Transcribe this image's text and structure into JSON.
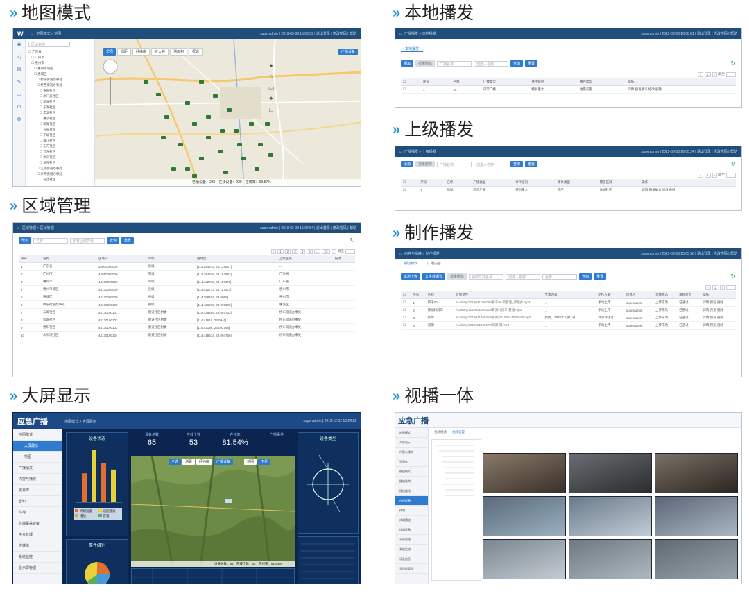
{
  "sections": {
    "map": {
      "title": "地图模式"
    },
    "local": {
      "title": "本地播发"
    },
    "upper": {
      "title": "上级播发"
    },
    "region": {
      "title": "区域管理"
    },
    "make": {
      "title": "制作播发"
    },
    "screen": {
      "title": "大屏显示"
    },
    "video": {
      "title": "视播一体"
    }
  },
  "map_shot": {
    "crumb": "地图模式 > 地图",
    "user_info": "superadmin | 2019-03-08 15:08:39 | 退出登录 | 修改密码 | 帮助",
    "search_placeholder": "区域名称",
    "tree": [
      "广东省",
      "广州市",
      "惠州市",
      "惠州市城区",
      "惠城区",
      "桥东街道办事处",
      "桥西街道办事处",
      "惠阳社区",
      "水门居社区",
      "新湖社区",
      "东湖社区",
      "丰源社区",
      "惠淡社区",
      "新湖社区",
      "花园社区",
      "下城社区",
      "横江社区",
      "东方社区",
      "江东社区",
      "水贝社区",
      "湖东社区",
      "江北街道办事处",
      "东平街道办事处",
      "花边社区"
    ],
    "toolbar": [
      "全选",
      "测距",
      "经纬度",
      "扩大包",
      "测面积",
      "框选"
    ],
    "right_btn": "广播设备",
    "bottom_info": "已播设备：230　在线设备：229　在线率：99.57%"
  },
  "local_shot": {
    "crumb": "广播播发 > 本地播发",
    "user_info": "superadmin | 2019-03-08 16:08:01 | 退出登录 | 修改密码 | 帮助",
    "tab": "本地播发",
    "add_btn": "添加",
    "del_btn": "批量删除",
    "search1": "广播名称",
    "search2": "创建人名称",
    "query_btn": "查询",
    "reset_btn": "重置",
    "columns": [
      "序号",
      "名称",
      "广播类型",
      "事件级别",
      "事件类型",
      "操作"
    ],
    "rows": [
      {
        "no": "1",
        "name": "66",
        "type": "日常广播",
        "level": "特别重大",
        "etype": "地震灾害",
        "ops": "详情 播发确认 修改 删除"
      }
    ],
    "page_label": "跳至"
  },
  "upper_shot": {
    "crumb": "广播播发 > 上级播发",
    "user_info": "superadmin | 2019-03-08 16:00:24 | 退出登录 | 修改密码 | 帮助",
    "add_btn": "添加",
    "del_btn": "批量删除",
    "search1": "广播名称",
    "search2": "创建人名称",
    "query_btn": "查询",
    "reset_btn": "重置",
    "columns": [
      "序号",
      "名称",
      "广播类型",
      "事件级别",
      "事件类型",
      "覆盖区域",
      "操作"
    ],
    "rows": [
      {
        "no": "1",
        "name": "测试",
        "type": "应急广播",
        "level": "特别重大",
        "etype": "疫严",
        "area": "东湖社区",
        "ops": "详情 播发确认 修改 删除"
      }
    ],
    "page_label": "跳至"
  },
  "region_shot": {
    "crumb": "区域管理 > 区域管理",
    "user_info": "superadmin | 2019-03-08 15:04:54 | 退出登录 | 修改密码 | 帮助",
    "add_btn": "增加",
    "search1": "名称",
    "search2": "所有区域等级",
    "query_btn": "查询",
    "reset_btn": "重置",
    "columns": [
      "序号",
      "名称",
      "区域码",
      "等级",
      "经纬度",
      "上级区域",
      "描述"
    ],
    "rows": [
      {
        "no": "1",
        "name": "广东省",
        "code": "44000000000",
        "level": "省级",
        "coord": "[113.264474, 23.129537]",
        "parent": "--"
      },
      {
        "no": "2",
        "name": "广州市",
        "code": "44010000000",
        "level": "市级",
        "coord": "[113.264919, 23.153887]",
        "parent": "广东省"
      },
      {
        "no": "3",
        "name": "惠州市",
        "code": "44130000000",
        "level": "市级",
        "coord": "[114.422773, 23.117473]",
        "parent": "广东省"
      },
      {
        "no": "4",
        "name": "惠州市城区",
        "code": "44130200000",
        "level": "县级",
        "coord": "[114.422773, 23.117473]",
        "parent": "惠州市"
      },
      {
        "no": "5",
        "name": "惠城区",
        "code": "44130200000",
        "level": "县级",
        "coord": "[114.388461, 23.0968]",
        "parent": "惠州市"
      },
      {
        "no": "6",
        "name": "桥东街道办事处",
        "code": "44130200100",
        "level": "镇级",
        "coord": "[114.426273, 23.090899]",
        "parent": "惠城区"
      },
      {
        "no": "7",
        "name": "东湖社区",
        "code": "44130100101",
        "level": "街道社区村委",
        "coord": "[114.436469, 23.087733]",
        "parent": "桥东街道办事处"
      },
      {
        "no": "8",
        "name": "新湖社区",
        "code": "44130100102",
        "level": "街道社区村委",
        "coord": "[114.41616, 23.0946]",
        "parent": "桥东街道办事处"
      },
      {
        "no": "9",
        "name": "惠阳社区",
        "code": "44130100103",
        "level": "街道社区村委",
        "coord": "[114.42198, 23.092768]",
        "parent": "桥东街道办事处"
      },
      {
        "no": "10",
        "name": "水贝湾社区",
        "code": "44130100104",
        "level": "街道社区村委",
        "coord": "[114.418634, 23.094758]",
        "parent": "桥东街道办事处"
      }
    ],
    "pages": [
      "1",
      "2",
      "3",
      "4",
      "5",
      "...",
      "23"
    ],
    "page_label": "跳至"
  },
  "make_shot": {
    "crumb": "内容与播映 > 制作播发",
    "user_info": "superadmin | 2019-03-08 15:05:56 | 退出登录 | 修改密码 | 帮助",
    "tabs": [
      "辅助制作",
      "广播内容"
    ],
    "btns": [
      "本地上传",
      "文字转语音",
      "批量删除"
    ],
    "search1": "辅助文件名称",
    "search2": "创建人名称",
    "select": "全部",
    "query_btn": "查询",
    "reset_btn": "重置",
    "columns": [
      "序号",
      "名称",
      "音频文件",
      "文本内容",
      "制作方式",
      "创建人",
      "音频状态",
      "审核状态",
      "操作"
    ],
    "rows": [
      {
        "no": "1",
        "name": "新干00",
        "file": "Auxiliary/2019021090730/新干00-新喜佳_新能办.mp3",
        "text": "...",
        "mode": "手动上传",
        "user": "superadmin",
        "astatus": "上传成功",
        "review": "已通过",
        "ops": "详情 预览 删除"
      },
      {
        "no": "2",
        "name": "黄湖村周年",
        "file": "Auxiliary/2019021409365/黄湖村周年-黄湖.mp3",
        "text": "...",
        "mode": "手动上传",
        "user": "superadmin",
        "astatus": "上传成功",
        "review": "已通过",
        "ops": "详情 预览 删除"
      },
      {
        "no": "3",
        "name": "新闻",
        "file": "Auxiliary/2019021409394/新闻/2019021409384B.mp3",
        "text": "新闻，1976年4月11日...",
        "mode": "文字转语音",
        "user": "superadmin",
        "astatus": "上传成功",
        "review": "已通过",
        "ops": "详情 预览 删除"
      },
      {
        "no": "4",
        "name": "测测",
        "file": "Auxiliary/2019021409570/测测-测.mp3",
        "text": "...",
        "mode": "手动上传",
        "user": "superadmin",
        "astatus": "上传成功",
        "review": "已通过",
        "ops": "详情 预览 删除"
      }
    ]
  },
  "screen_shot": {
    "logo": "应急广播",
    "crumb": "地图模式 > 大屏展示",
    "user_info": "superadmin | 2019-12-12 16:24:22",
    "menu": [
      "地图模式",
      "大屏展示",
      "地图",
      "广播播发",
      "内容与播映",
      "资源库",
      "告知",
      "终端",
      "终端覆盖设备",
      "平台管理",
      "终端维",
      "系统监控",
      "显示屏管理"
    ],
    "panels": {
      "device_status": "设备状态",
      "event_stat": "事件级别",
      "device_type": "设备类型"
    },
    "kpi": [
      {
        "label": "设备总数",
        "value": "65"
      },
      {
        "label": "在线个数",
        "value": "53"
      },
      {
        "label": "在线率",
        "value": "81.54%"
      },
      {
        "label": "广播事件",
        "value": ""
      }
    ],
    "bar_values": [
      0.55,
      1.0,
      0.75,
      0.62
    ],
    "legend": [
      "终端设备",
      "适配播放",
      "播放",
      "音箱"
    ],
    "map_tools": [
      "全选",
      "测距",
      "经纬度",
      "广播设备",
      "地图",
      "卫星"
    ],
    "bottom_info": "设备总数：65　在线个数：53　在线率：81.54%"
  },
  "video_shot": {
    "logo": "应急广播",
    "tabs": [
      "视频模式",
      "视频设置"
    ],
    "menu": [
      "地图模式",
      "大屏显示",
      "内容与播映",
      "资源库",
      "播放模式",
      "播放轮询",
      "播放路线",
      "在线设备",
      "终端",
      "终端播放",
      "终端设备",
      "平台管理",
      "系统监控",
      "设备信息",
      "显示屏管理"
    ]
  }
}
